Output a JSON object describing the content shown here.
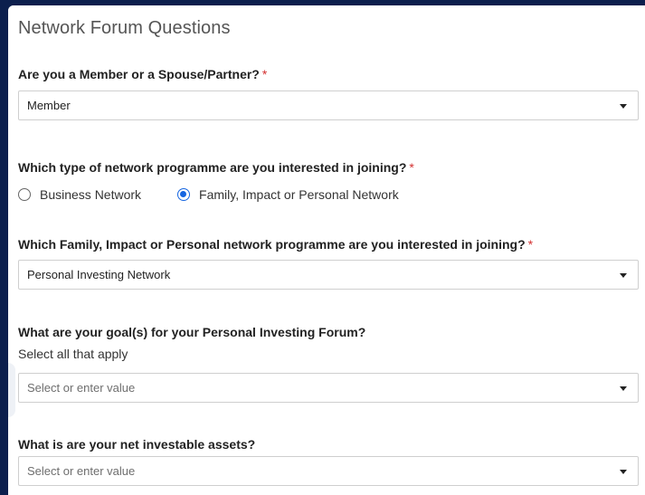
{
  "form": {
    "title": "Network Forum Questions",
    "required_marker": "*",
    "q1": {
      "label": "Are you a Member or a Spouse/Partner?",
      "value": "Member"
    },
    "q2": {
      "label": "Which type of network programme are you interested in joining?",
      "options": [
        {
          "label": "Business Network",
          "selected": false
        },
        {
          "label": "Family, Impact or Personal Network",
          "selected": true
        }
      ]
    },
    "q3": {
      "label": "Which Family, Impact or Personal network programme are you interested in joining?",
      "value": "Personal Investing Network"
    },
    "q4": {
      "label": "What are your goal(s) for your Personal Investing Forum?",
      "hint": "Select all that apply",
      "placeholder": "Select or enter value"
    },
    "q5": {
      "label": "What is are your net investable assets?",
      "placeholder": "Select or enter value"
    }
  },
  "colors": {
    "background": "#0c1f4d",
    "accent": "#1565e0",
    "required": "#d32f2f"
  }
}
